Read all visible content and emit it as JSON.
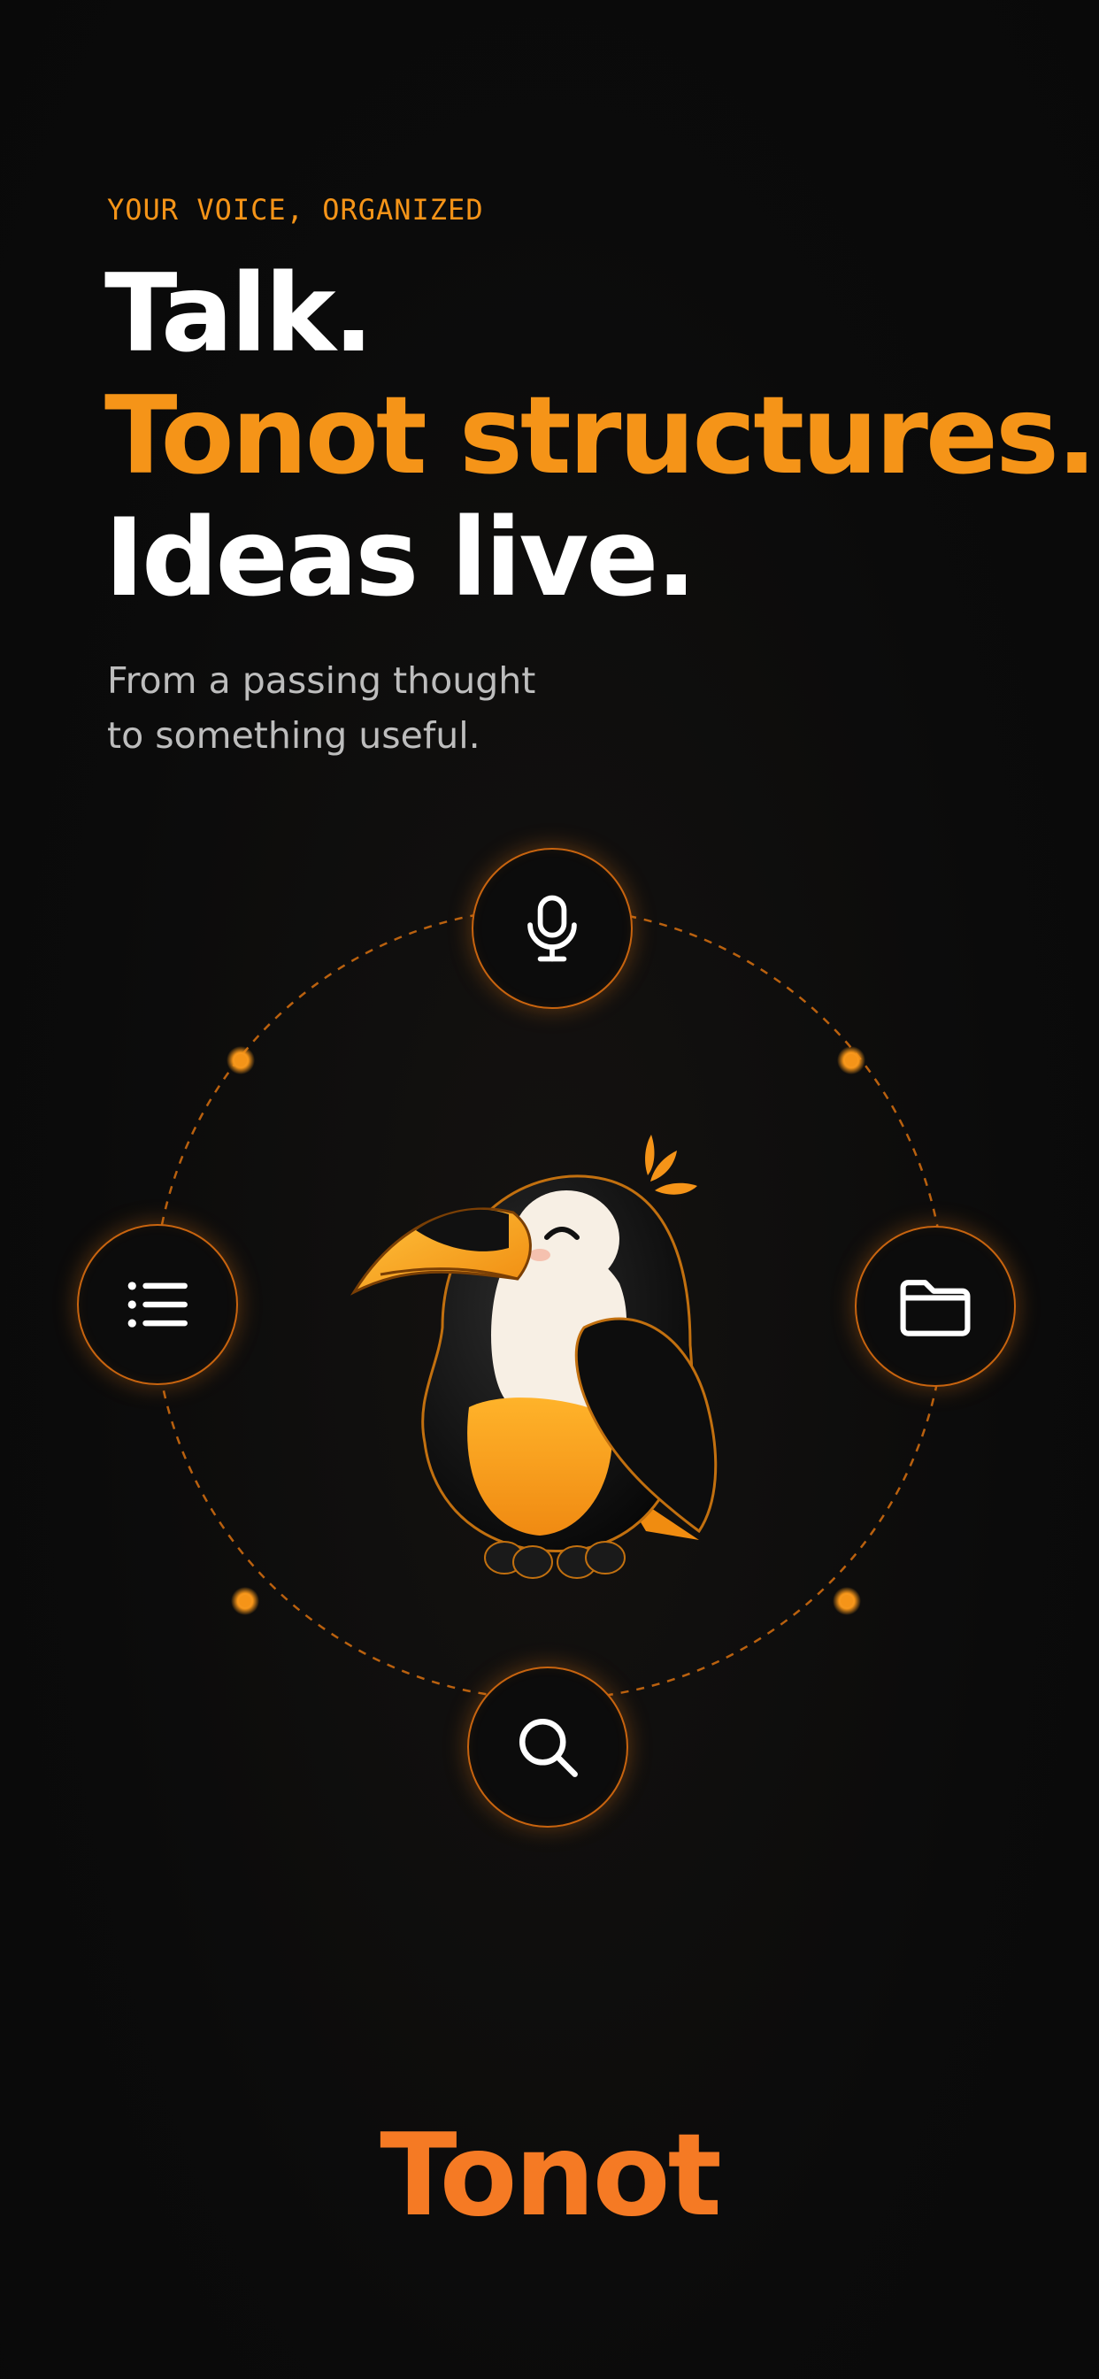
{
  "eyebrow": "YOUR VOICE, ORGANIZED",
  "headline": {
    "line1": "Talk.",
    "line2": "Tonot structures.",
    "line3": "Ideas live."
  },
  "subtitle": {
    "line1": "From a passing thought",
    "line2": "to something useful."
  },
  "orbit": {
    "nodes": [
      {
        "name": "microphone",
        "icon": "microphone-icon"
      },
      {
        "name": "list",
        "icon": "list-icon"
      },
      {
        "name": "folder",
        "icon": "folder-icon"
      },
      {
        "name": "search",
        "icon": "search-icon"
      }
    ],
    "mascot": "toucan-mascot"
  },
  "brand": "Tonot",
  "colors": {
    "background": "#0b0b0b",
    "accent": "#f59418",
    "brand": "#f57a24",
    "text_primary": "#ffffff",
    "text_secondary": "#bdbdbd"
  }
}
